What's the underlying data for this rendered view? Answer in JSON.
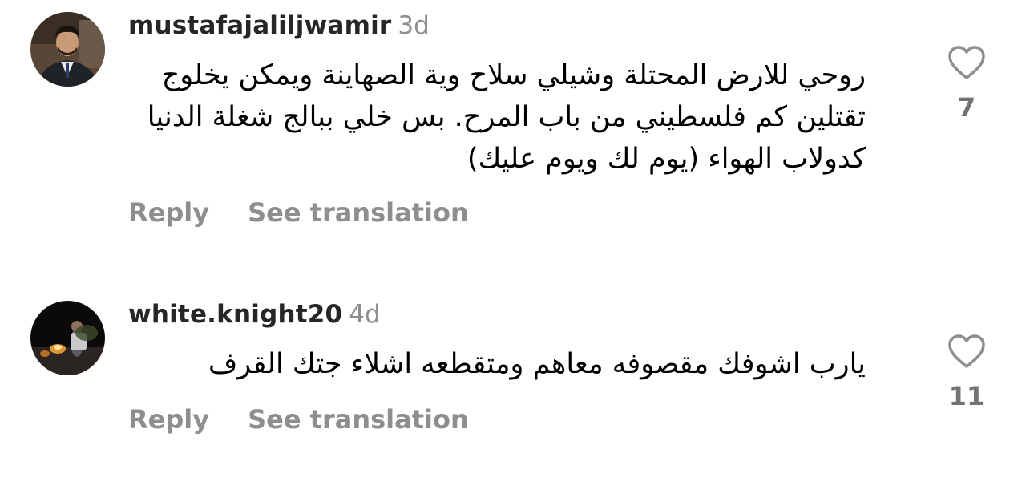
{
  "comments": [
    {
      "username": "mustafajaliljwamir",
      "time": "3d",
      "text": "روحي للارض المحتلة وشيلي سلاح وية الصهاينة ويمكن يخلوج تقتلين كم فلسطيني من باب المرح. بس خلي ببالج شغلة  الدنيا كدولاب الهواء (يوم لك ويوم عليك)",
      "reply_label": "Reply",
      "translate_label": "See translation",
      "likes": "7",
      "avatar_icon": "profile-photo-man-suit"
    },
    {
      "username": "white.knight20",
      "time": "4d",
      "text": "يارب اشوفك مقصوفه معاهم ومتقطعه اشلاء جتك القرف",
      "reply_label": "Reply",
      "translate_label": "See translation",
      "likes": "11",
      "avatar_icon": "profile-photo-night-fire"
    }
  ],
  "colors": {
    "username": "#262626",
    "secondary_text": "#8e8e8e",
    "like_count": "#737373",
    "heart_stroke": "#8e8e8e"
  },
  "icons": {
    "like": "heart-outline-icon"
  }
}
